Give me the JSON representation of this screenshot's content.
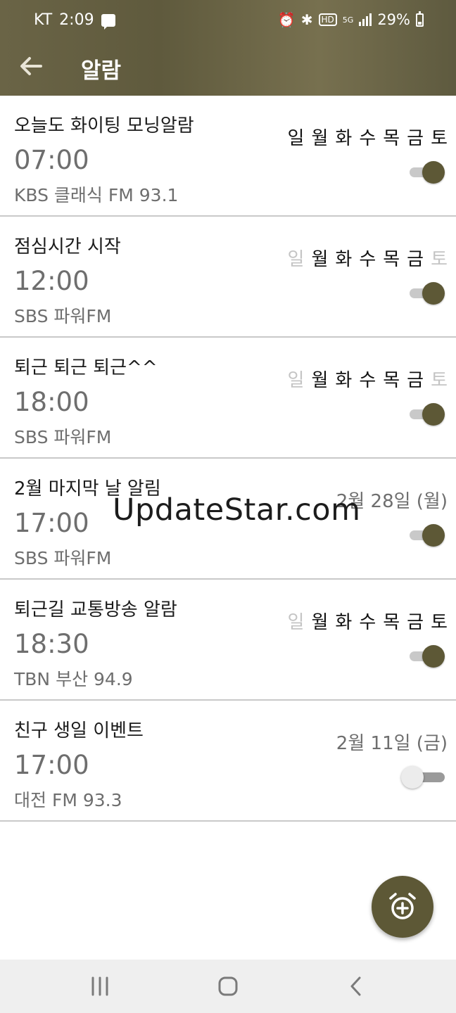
{
  "status": {
    "carrier": "KT",
    "time": "2:09",
    "hd": "HD",
    "network": "5G",
    "battery": "29%"
  },
  "appbar": {
    "title": "알람"
  },
  "alarms": [
    {
      "name": "오늘도 화이팅 모닝알람",
      "time": "07:00",
      "station": "KBS 클래식 FM 93.1",
      "days": [
        {
          "label": "일",
          "on": true
        },
        {
          "label": "월",
          "on": true
        },
        {
          "label": "화",
          "on": true
        },
        {
          "label": "수",
          "on": true
        },
        {
          "label": "목",
          "on": true
        },
        {
          "label": "금",
          "on": true
        },
        {
          "label": "토",
          "on": true
        }
      ],
      "enabled": true
    },
    {
      "name": "점심시간 시작",
      "time": "12:00",
      "station": "SBS 파워FM",
      "days": [
        {
          "label": "일",
          "on": false
        },
        {
          "label": "월",
          "on": true
        },
        {
          "label": "화",
          "on": true
        },
        {
          "label": "수",
          "on": true
        },
        {
          "label": "목",
          "on": true
        },
        {
          "label": "금",
          "on": true
        },
        {
          "label": "토",
          "on": false
        }
      ],
      "enabled": true
    },
    {
      "name": "퇴근 퇴근 퇴근^^",
      "time": "18:00",
      "station": "SBS 파워FM",
      "days": [
        {
          "label": "일",
          "on": false
        },
        {
          "label": "월",
          "on": true
        },
        {
          "label": "화",
          "on": true
        },
        {
          "label": "수",
          "on": true
        },
        {
          "label": "목",
          "on": true
        },
        {
          "label": "금",
          "on": true
        },
        {
          "label": "토",
          "on": false
        }
      ],
      "enabled": true
    },
    {
      "name": "2월 마지막 날 알림",
      "time": "17:00",
      "station": "SBS 파워FM",
      "date": "2월 28일 (월)",
      "enabled": true
    },
    {
      "name": "퇴근길 교통방송 알람",
      "time": "18:30",
      "station": "TBN 부산 94.9",
      "days": [
        {
          "label": "일",
          "on": false
        },
        {
          "label": "월",
          "on": true
        },
        {
          "label": "화",
          "on": true
        },
        {
          "label": "수",
          "on": true
        },
        {
          "label": "목",
          "on": true
        },
        {
          "label": "금",
          "on": true
        },
        {
          "label": "토",
          "on": true
        }
      ],
      "enabled": true
    },
    {
      "name": "친구 생일 이벤트",
      "time": "17:00",
      "station": "대전 FM 93.3",
      "date": "2월 11일 (금)",
      "enabled": false
    }
  ],
  "watermark": "UpdateStar.com",
  "colors": {
    "accent": "#5d5836",
    "appbar": "#6a6446"
  },
  "icons": {
    "back": "arrow-left-icon",
    "fab": "add-alarm-icon"
  }
}
